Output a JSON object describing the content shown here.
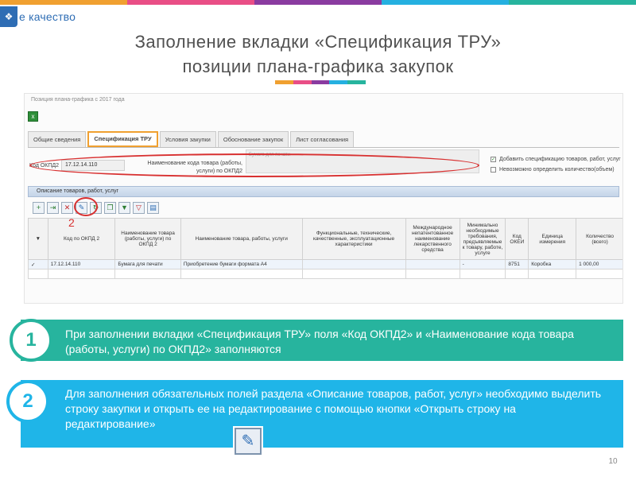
{
  "header": {
    "org_name": "е качество",
    "colors": [
      "#f0a030",
      "#e94e86",
      "#8a3ba0",
      "#25b0e0",
      "#27b49e",
      "#f3c53a"
    ]
  },
  "title": {
    "line1": "Заполнение вкладки «Спецификация ТРУ»",
    "line2": "позиции плана-графика закупок",
    "bar_colors": [
      "#f0a030",
      "#e94e86",
      "#8a3ba0",
      "#25b0e0",
      "#27b49e"
    ]
  },
  "screenshot": {
    "caption": "Позиция плана-графика с 2017 года",
    "tabs": [
      {
        "label": "Общие сведения",
        "active": false
      },
      {
        "label": "Спецификация ТРУ",
        "active": true
      },
      {
        "label": "Условия закупки",
        "active": false
      },
      {
        "label": "Обоснование закупок",
        "active": false
      },
      {
        "label": "Лист согласования",
        "active": false
      }
    ],
    "okpd_label": "Код ОКПД2",
    "okpd_value": "17.12.14.110",
    "name_label": "Наименование кода товара (работы, услуги) по ОКПД2",
    "name_value": "Бумага для печати",
    "checkbox_add": "Добавить спецификацию товаров, работ, услуг",
    "checkbox_undefined": "Невозможно определить количество(объем)",
    "section_title": "Описание товаров, работ, услуг",
    "marker1": "1",
    "marker2": "2",
    "table": {
      "headers": [
        "",
        "Код по ОКПД 2",
        "Наименование товара (работы, услуги) по ОКПД 2",
        "Наименование товара, работы, услуги",
        "Функциональные, технические, качественные, эксплуатационные характеристики",
        "Международное непатентованное наименование лекарственного средства",
        "Минимально необходимые требования, предъявляемые к товару, работе, услуге",
        "Код ОКЕИ",
        "Единица измерения",
        "Количество (всего)"
      ],
      "rows": [
        [
          "✓",
          "17.12.14.110",
          "Бумага для печати",
          "Приобретение бумаги формата А4",
          "",
          "",
          "-",
          "8751",
          "Коробка",
          "1 000,00"
        ]
      ]
    }
  },
  "panel1": {
    "number": "1",
    "text": "При заполнении вкладки «Спецификация ТРУ» поля «Код ОКПД2» и «Наименование кода товара (работы, услуги) по ОКПД2» заполняются"
  },
  "panel2": {
    "number": "2",
    "text": "Для заполнения обязательных полей раздела «Описание товаров, работ, услуг» необходимо выделить строку закупки  и открыть ее на редактирование с помощью кнопки  «Открыть строку на редактирование»"
  },
  "page_number": "10"
}
